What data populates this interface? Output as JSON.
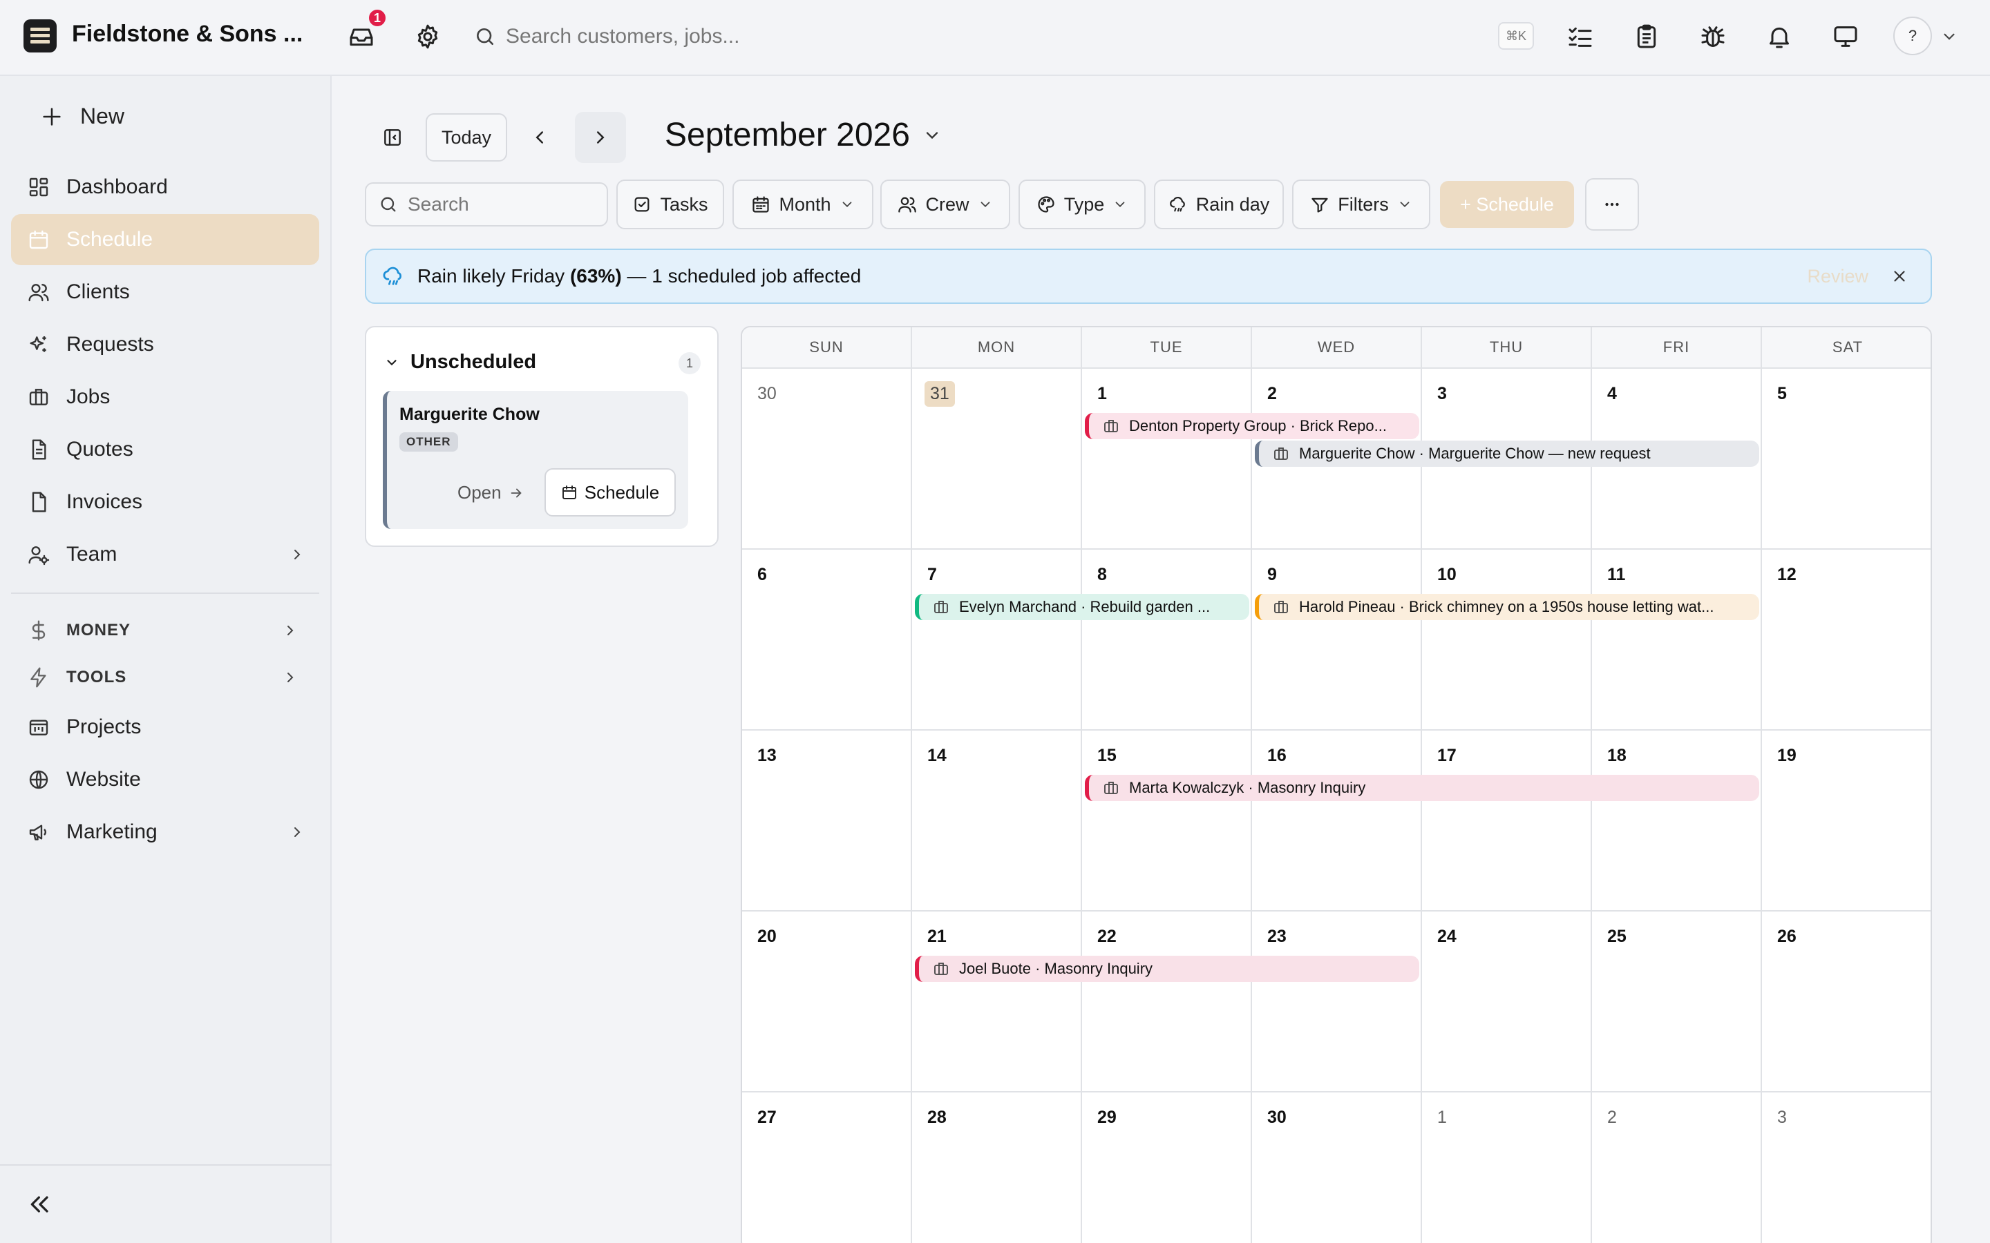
{
  "app": {
    "org_name": "Fieldstone & Sons ...",
    "inbox_badge": "1",
    "search_placeholder": "Search customers, jobs...",
    "shortcut": "⌘K",
    "help": "?"
  },
  "sidebar": {
    "new_label": "New",
    "items": [
      {
        "label": "Dashboard",
        "icon": "dashboard-icon"
      },
      {
        "label": "Schedule",
        "icon": "calendar-icon",
        "active": true
      },
      {
        "label": "Clients",
        "icon": "users-icon"
      },
      {
        "label": "Requests",
        "icon": "sparkle-icon"
      },
      {
        "label": "Jobs",
        "icon": "briefcase-icon"
      },
      {
        "label": "Quotes",
        "icon": "document-icon"
      },
      {
        "label": "Invoices",
        "icon": "invoice-icon"
      },
      {
        "label": "Team",
        "icon": "team-icon"
      }
    ],
    "sections": [
      {
        "label": "MONEY",
        "icon": "dollar-icon"
      },
      {
        "label": "TOOLS",
        "icon": "bolt-icon"
      }
    ],
    "extra": [
      {
        "label": "Projects",
        "icon": "projects-icon"
      },
      {
        "label": "Website",
        "icon": "globe-icon"
      },
      {
        "label": "Marketing",
        "icon": "megaphone-icon"
      }
    ]
  },
  "toolbar": {
    "today": "Today",
    "month_title": "September 2026",
    "search_placeholder": "Search",
    "tasks": "Tasks",
    "month": "Month",
    "crew": "Crew",
    "type": "Type",
    "rain_day": "Rain day",
    "filters": "Filters",
    "schedule": "+ Schedule"
  },
  "banner": {
    "prefix": "Rain likely Friday ",
    "chance": "(63%)",
    "suffix": " — 1 scheduled job affected",
    "review": "Review"
  },
  "unscheduled": {
    "title": "Unscheduled",
    "count": "1",
    "card": {
      "name": "Marguerite Chow",
      "tag": "OTHER",
      "open": "Open",
      "schedule": "Schedule"
    }
  },
  "calendar": {
    "weekdays": [
      "SUN",
      "MON",
      "TUE",
      "WED",
      "THU",
      "FRI",
      "SAT"
    ],
    "days": [
      [
        "30",
        "31",
        "1",
        "2",
        "3",
        "4",
        "5"
      ],
      [
        "6",
        "7",
        "8",
        "9",
        "10",
        "11",
        "12"
      ],
      [
        "13",
        "14",
        "15",
        "16",
        "17",
        "18",
        "19"
      ],
      [
        "20",
        "21",
        "22",
        "23",
        "24",
        "25",
        "26"
      ],
      [
        "27",
        "28",
        "29",
        "30",
        "1",
        "2",
        "3"
      ]
    ],
    "events": [
      {
        "label": "Denton Property Group · Brick Repo...",
        "week": 0,
        "start": 2,
        "span": 2,
        "lane": 0,
        "color": "#e11d48",
        "bg": "#fbe3ea"
      },
      {
        "label": "Marguerite Chow · Marguerite Chow — new request",
        "week": 0,
        "start": 3,
        "span": 3,
        "lane": 1,
        "color": "#6b7a90",
        "bg": "#e7e9ed"
      },
      {
        "label": "Evelyn Marchand · Rebuild garden ...",
        "week": 1,
        "start": 1,
        "span": 2,
        "lane": 0,
        "color": "#10b981",
        "bg": "#dcf3ec"
      },
      {
        "label": "Harold Pineau · Brick chimney on a 1950s house letting wat...",
        "week": 1,
        "start": 3,
        "span": 3,
        "lane": 0,
        "color": "#f59e0b",
        "bg": "#fbeedd"
      },
      {
        "label": "Marta Kowalczyk · Masonry Inquiry",
        "week": 2,
        "start": 2,
        "span": 4,
        "lane": 0,
        "color": "#e11d48",
        "bg": "#f9e1e8"
      },
      {
        "label": "Joel Buote · Masonry Inquiry",
        "week": 3,
        "start": 1,
        "span": 3,
        "lane": 0,
        "color": "#e11d48",
        "bg": "#f9e1e8"
      }
    ]
  }
}
